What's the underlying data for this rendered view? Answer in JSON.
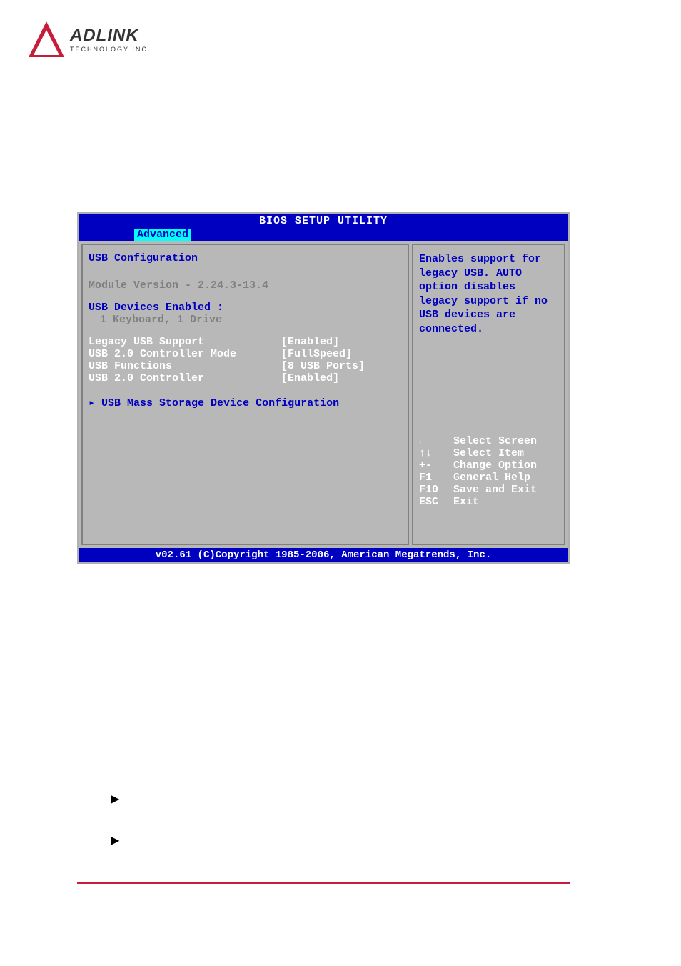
{
  "logo": {
    "name": "ADLINK",
    "subtitle": "TECHNOLOGY INC."
  },
  "bios": {
    "title": "BIOS SETUP UTILITY",
    "tab": "Advanced",
    "section_title": "USB Configuration",
    "module_version": "Module Version - 2.24.3-13.4",
    "devices_enabled_label": "USB Devices Enabled :",
    "devices_enabled_value": "1 Keyboard, 1 Drive",
    "options": [
      {
        "label": "Legacy USB Support",
        "value": "[Enabled]"
      },
      {
        "label": "USB 2.0 Controller Mode",
        "value": "[FullSpeed]"
      },
      {
        "label": "USB Functions",
        "value": "[8 USB Ports]"
      },
      {
        "label": "USB 2.0 Controller",
        "value": "[Enabled]"
      }
    ],
    "submenu": "▸ USB Mass Storage Device Configuration",
    "help_text": "Enables support for legacy USB. AUTO option disables legacy support if no USB devices are connected.",
    "nav": [
      {
        "key": "←",
        "label": "Select Screen"
      },
      {
        "key": "↑↓",
        "label": "Select Item"
      },
      {
        "key": "+-",
        "label": "Change Option"
      },
      {
        "key": "F1",
        "label": "General Help"
      },
      {
        "key": "F10",
        "label": "Save and Exit"
      },
      {
        "key": "ESC",
        "label": "Exit"
      }
    ],
    "footer": "v02.61 (C)Copyright 1985-2006, American Megatrends, Inc."
  }
}
